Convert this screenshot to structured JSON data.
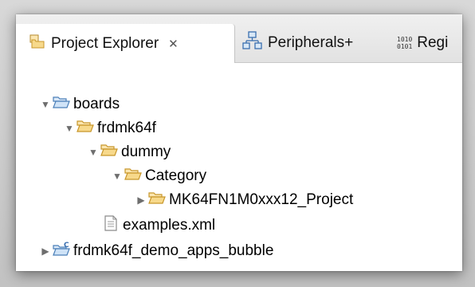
{
  "tabs": [
    {
      "label": "Project Explorer",
      "icon": "project-explorer-icon",
      "close": "✕",
      "active": true
    },
    {
      "label": "Peripherals+",
      "icon": "peripherals-icon",
      "active": false
    },
    {
      "label": "Regi",
      "icon": "registers-icon",
      "active": false
    }
  ],
  "registers_icon_text": {
    "line1": "1010",
    "line2": "0101"
  },
  "tree": {
    "items": [
      {
        "label": "boards",
        "icon": "open-folder-icon",
        "expanded": true
      },
      {
        "label": "frdmk64f",
        "icon": "open-folder-icon",
        "expanded": true
      },
      {
        "label": "dummy",
        "icon": "open-folder-icon",
        "expanded": true
      },
      {
        "label": "Category",
        "icon": "open-folder-icon",
        "expanded": true
      },
      {
        "label": "MK64FN1M0xxx12_Project",
        "icon": "open-folder-icon",
        "expanded": false
      },
      {
        "label": "examples.xml",
        "icon": "file-icon"
      },
      {
        "label": "frdmk64f_demo_apps_bubble",
        "icon": "c-project-folder-icon",
        "expanded": false
      }
    ]
  },
  "colors": {
    "folder_fill": "#f7d98b",
    "folder_stroke": "#c8962a",
    "folder_blue_fill": "#cfe3f7",
    "folder_blue_stroke": "#4a7fb8",
    "tab_active_bg": "#ffffff",
    "tab_bar_bg": "#e6e6e6"
  }
}
